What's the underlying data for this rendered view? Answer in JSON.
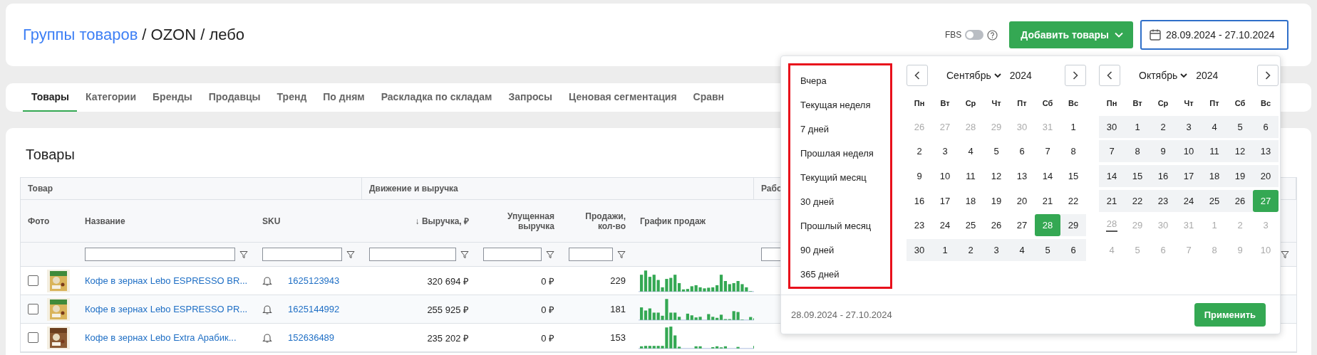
{
  "header": {
    "breadcrumb_link": "Группы товаров",
    "breadcrumb_path": "/ OZON / лебо",
    "fbs": {
      "label": "FBS",
      "on": false
    },
    "add_button": {
      "label": "Добавить товары"
    },
    "date_field": {
      "value": "28.09.2024 - 27.10.2024",
      "focused": true
    }
  },
  "tabs": [
    {
      "label": "Товары",
      "selected": true
    },
    {
      "label": "Категории",
      "selected": false
    },
    {
      "label": "Бренды",
      "selected": false
    },
    {
      "label": "Продавцы",
      "selected": false
    },
    {
      "label": "Тренд",
      "selected": false
    },
    {
      "label": "По дням",
      "selected": false
    },
    {
      "label": "Раскладка по складам",
      "selected": false
    },
    {
      "label": "Запросы",
      "selected": false
    },
    {
      "label": "Ценовая сегментация",
      "selected": false
    },
    {
      "label": "Сравн",
      "selected": false
    }
  ],
  "products": {
    "title": "Товары",
    "groups": [
      {
        "label": "Товар"
      },
      {
        "label": "Движение и выручка"
      },
      {
        "label": "Рабо"
      }
    ],
    "columns": [
      {
        "label": "Фото",
        "filter": false
      },
      {
        "label": "Название",
        "filter": true
      },
      {
        "label": "SKU",
        "filter": true
      },
      {
        "label": "↓ Выручка, ₽",
        "filter": true
      },
      {
        "label": "Упущенная выручка",
        "filter": true
      },
      {
        "label": "Продажи, кол-во",
        "filter": true
      },
      {
        "label": "График продаж",
        "filter": false
      },
      {
        "filter": true
      }
    ],
    "rows": [
      {
        "checked": false,
        "name": "Кофе в зернах Lebo ESPRESSO BR...",
        "sku": "1625123943",
        "revenue": "320 694 ₽",
        "lost": "0 ₽",
        "sales": "229"
      },
      {
        "checked": false,
        "name": "Кофе в зернах Lebo ESPRESSO PR...",
        "sku": "1625144992",
        "revenue": "255 925 ₽",
        "lost": "0 ₽",
        "sales": "181"
      },
      {
        "checked": false,
        "name": "Кофе в зернах Lebo Extra Арабик...",
        "sku": "152636489",
        "revenue": "235 202 ₽",
        "lost": "0 ₽",
        "sales": "153"
      }
    ]
  },
  "date_picker": {
    "presets": [
      "Вчера",
      "Текущая неделя",
      "7 дней",
      "Прошлая неделя",
      "Текущий месяц",
      "30 дней",
      "Прошлый месяц",
      "90 дней",
      "365 дней"
    ],
    "calendars": [
      {
        "month": "Сентябрь",
        "year": "2024",
        "weekdays": [
          "Пн",
          "Вт",
          "Ср",
          "Чт",
          "Пт",
          "Сб",
          "Вс"
        ],
        "weeks": [
          [
            {
              "day": "26",
              "muted": true,
              "in_range": false,
              "selected": false,
              "today": false
            },
            {
              "day": "27",
              "muted": true,
              "in_range": false,
              "selected": false,
              "today": false
            },
            {
              "day": "28",
              "muted": true,
              "in_range": false,
              "selected": false,
              "today": false
            },
            {
              "day": "29",
              "muted": true,
              "in_range": false,
              "selected": false,
              "today": false
            },
            {
              "day": "30",
              "muted": true,
              "in_range": false,
              "selected": false,
              "today": false
            },
            {
              "day": "31",
              "muted": true,
              "in_range": false,
              "selected": false,
              "today": false
            },
            {
              "day": "1",
              "muted": false,
              "in_range": false,
              "selected": false,
              "today": false
            }
          ],
          [
            {
              "day": "2",
              "muted": false,
              "in_range": false,
              "selected": false,
              "today": false
            },
            {
              "day": "3",
              "muted": false,
              "in_range": false,
              "selected": false,
              "today": false
            },
            {
              "day": "4",
              "muted": false,
              "in_range": false,
              "selected": false,
              "today": false
            },
            {
              "day": "5",
              "muted": false,
              "in_range": false,
              "selected": false,
              "today": false
            },
            {
              "day": "6",
              "muted": false,
              "in_range": false,
              "selected": false,
              "today": false
            },
            {
              "day": "7",
              "muted": false,
              "in_range": false,
              "selected": false,
              "today": false
            },
            {
              "day": "8",
              "muted": false,
              "in_range": false,
              "selected": false,
              "today": false
            }
          ],
          [
            {
              "day": "9",
              "muted": false,
              "in_range": false,
              "selected": false,
              "today": false
            },
            {
              "day": "10",
              "muted": false,
              "in_range": false,
              "selected": false,
              "today": false
            },
            {
              "day": "11",
              "muted": false,
              "in_range": false,
              "selected": false,
              "today": false
            },
            {
              "day": "12",
              "muted": false,
              "in_range": false,
              "selected": false,
              "today": false
            },
            {
              "day": "13",
              "muted": false,
              "in_range": false,
              "selected": false,
              "today": false
            },
            {
              "day": "14",
              "muted": false,
              "in_range": false,
              "selected": false,
              "today": false
            },
            {
              "day": "15",
              "muted": false,
              "in_range": false,
              "selected": false,
              "today": false
            }
          ],
          [
            {
              "day": "16",
              "muted": false,
              "in_range": false,
              "selected": false,
              "today": false
            },
            {
              "day": "17",
              "muted": false,
              "in_range": false,
              "selected": false,
              "today": false
            },
            {
              "day": "18",
              "muted": false,
              "in_range": false,
              "selected": false,
              "today": false
            },
            {
              "day": "19",
              "muted": false,
              "in_range": false,
              "selected": false,
              "today": false
            },
            {
              "day": "20",
              "muted": false,
              "in_range": false,
              "selected": false,
              "today": false
            },
            {
              "day": "21",
              "muted": false,
              "in_range": false,
              "selected": false,
              "today": false
            },
            {
              "day": "22",
              "muted": false,
              "in_range": false,
              "selected": false,
              "today": false
            }
          ],
          [
            {
              "day": "23",
              "muted": false,
              "in_range": false,
              "selected": false,
              "today": false
            },
            {
              "day": "24",
              "muted": false,
              "in_range": false,
              "selected": false,
              "today": false
            },
            {
              "day": "25",
              "muted": false,
              "in_range": false,
              "selected": false,
              "today": false
            },
            {
              "day": "26",
              "muted": false,
              "in_range": false,
              "selected": false,
              "today": false
            },
            {
              "day": "27",
              "muted": false,
              "in_range": false,
              "selected": false,
              "today": false
            },
            {
              "day": "28",
              "muted": false,
              "in_range": true,
              "selected": true,
              "today": false
            },
            {
              "day": "29",
              "muted": false,
              "in_range": true,
              "selected": false,
              "today": false
            }
          ],
          [
            {
              "day": "30",
              "muted": false,
              "in_range": true,
              "selected": false,
              "today": false
            },
            {
              "day": "1",
              "muted": false,
              "in_range": true,
              "selected": false,
              "today": false
            },
            {
              "day": "2",
              "muted": false,
              "in_range": true,
              "selected": false,
              "today": false
            },
            {
              "day": "3",
              "muted": false,
              "in_range": true,
              "selected": false,
              "today": false
            },
            {
              "day": "4",
              "muted": false,
              "in_range": true,
              "selected": false,
              "today": false
            },
            {
              "day": "5",
              "muted": false,
              "in_range": true,
              "selected": false,
              "today": false
            },
            {
              "day": "6",
              "muted": false,
              "in_range": true,
              "selected": false,
              "today": false
            }
          ]
        ]
      },
      {
        "month": "Октябрь",
        "year": "2024",
        "weekdays": [
          "Пн",
          "Вт",
          "Ср",
          "Чт",
          "Пт",
          "Сб",
          "Вс"
        ],
        "weeks": [
          [
            {
              "day": "30",
              "muted": false,
              "in_range": true,
              "selected": false,
              "today": false
            },
            {
              "day": "1",
              "muted": false,
              "in_range": true,
              "selected": false,
              "today": false
            },
            {
              "day": "2",
              "muted": false,
              "in_range": true,
              "selected": false,
              "today": false
            },
            {
              "day": "3",
              "muted": false,
              "in_range": true,
              "selected": false,
              "today": false
            },
            {
              "day": "4",
              "muted": false,
              "in_range": true,
              "selected": false,
              "today": false
            },
            {
              "day": "5",
              "muted": false,
              "in_range": true,
              "selected": false,
              "today": false
            },
            {
              "day": "6",
              "muted": false,
              "in_range": true,
              "selected": false,
              "today": false
            }
          ],
          [
            {
              "day": "7",
              "muted": false,
              "in_range": true,
              "selected": false,
              "today": false
            },
            {
              "day": "8",
              "muted": false,
              "in_range": true,
              "selected": false,
              "today": false
            },
            {
              "day": "9",
              "muted": false,
              "in_range": true,
              "selected": false,
              "today": false
            },
            {
              "day": "10",
              "muted": false,
              "in_range": true,
              "selected": false,
              "today": false
            },
            {
              "day": "11",
              "muted": false,
              "in_range": true,
              "selected": false,
              "today": false
            },
            {
              "day": "12",
              "muted": false,
              "in_range": true,
              "selected": false,
              "today": false
            },
            {
              "day": "13",
              "muted": false,
              "in_range": true,
              "selected": false,
              "today": false
            }
          ],
          [
            {
              "day": "14",
              "muted": false,
              "in_range": true,
              "selected": false,
              "today": false
            },
            {
              "day": "15",
              "muted": false,
              "in_range": true,
              "selected": false,
              "today": false
            },
            {
              "day": "16",
              "muted": false,
              "in_range": true,
              "selected": false,
              "today": false
            },
            {
              "day": "17",
              "muted": false,
              "in_range": true,
              "selected": false,
              "today": false
            },
            {
              "day": "18",
              "muted": false,
              "in_range": true,
              "selected": false,
              "today": false
            },
            {
              "day": "19",
              "muted": false,
              "in_range": true,
              "selected": false,
              "today": false
            },
            {
              "day": "20",
              "muted": false,
              "in_range": true,
              "selected": false,
              "today": false
            }
          ],
          [
            {
              "day": "21",
              "muted": false,
              "in_range": true,
              "selected": false,
              "today": false
            },
            {
              "day": "22",
              "muted": false,
              "in_range": true,
              "selected": false,
              "today": false
            },
            {
              "day": "23",
              "muted": false,
              "in_range": true,
              "selected": false,
              "today": false
            },
            {
              "day": "24",
              "muted": false,
              "in_range": true,
              "selected": false,
              "today": false
            },
            {
              "day": "25",
              "muted": false,
              "in_range": true,
              "selected": false,
              "today": false
            },
            {
              "day": "26",
              "muted": false,
              "in_range": true,
              "selected": false,
              "today": false
            },
            {
              "day": "27",
              "muted": false,
              "in_range": true,
              "selected": true,
              "today": false
            }
          ],
          [
            {
              "day": "28",
              "muted": true,
              "in_range": false,
              "selected": false,
              "today": true
            },
            {
              "day": "29",
              "muted": true,
              "in_range": false,
              "selected": false,
              "today": false
            },
            {
              "day": "30",
              "muted": true,
              "in_range": false,
              "selected": false,
              "today": false
            },
            {
              "day": "31",
              "muted": true,
              "in_range": false,
              "selected": false,
              "today": false
            },
            {
              "day": "1",
              "muted": true,
              "in_range": false,
              "selected": false,
              "today": false
            },
            {
              "day": "2",
              "muted": true,
              "in_range": false,
              "selected": false,
              "today": false
            },
            {
              "day": "3",
              "muted": true,
              "in_range": false,
              "selected": false,
              "today": false
            }
          ],
          [
            {
              "day": "4",
              "muted": true,
              "in_range": false,
              "selected": false,
              "today": false
            },
            {
              "day": "5",
              "muted": true,
              "in_range": false,
              "selected": false,
              "today": false
            },
            {
              "day": "6",
              "muted": true,
              "in_range": false,
              "selected": false,
              "today": false
            },
            {
              "day": "7",
              "muted": true,
              "in_range": false,
              "selected": false,
              "today": false
            },
            {
              "day": "8",
              "muted": true,
              "in_range": false,
              "selected": false,
              "today": false
            },
            {
              "day": "9",
              "muted": true,
              "in_range": false,
              "selected": false,
              "today": false
            },
            {
              "day": "10",
              "muted": true,
              "in_range": false,
              "selected": false,
              "today": false
            }
          ]
        ]
      }
    ],
    "range_text": "28.09.2024 - 27.10.2024",
    "apply_button": "Применить"
  }
}
